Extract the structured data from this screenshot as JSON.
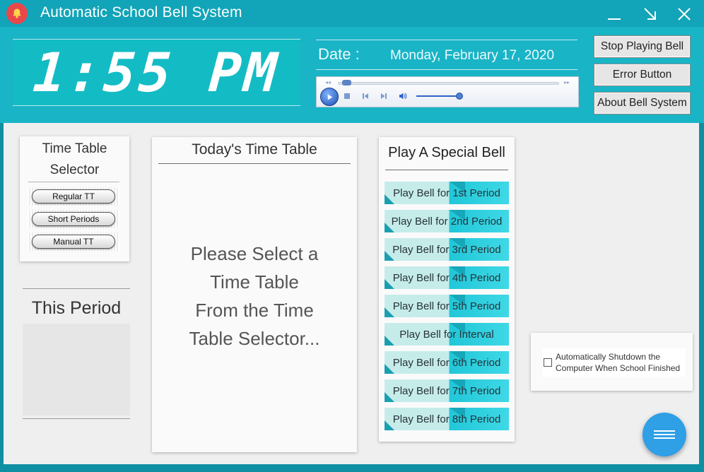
{
  "app": {
    "title": "Automatic School Bell System",
    "window_controls": [
      "minimize",
      "maximize",
      "close"
    ]
  },
  "header": {
    "time": "1:55 PM",
    "date_label": "Date :",
    "date_value": "Monday, February 17, 2020",
    "buttons": {
      "stop": "Stop Playing Bell",
      "error": "Error Button",
      "about": "About Bell System"
    },
    "player": {
      "controls": [
        "play-icon",
        "stop-icon",
        "previous-icon",
        "next-icon",
        "volume-icon"
      ],
      "seek_position": 0.02,
      "volume_level": 0.9
    }
  },
  "tt_selector": {
    "title_line1": "Time Table",
    "title_line2": "Selector",
    "options": [
      "Regular TT",
      "Short Periods",
      "Manual TT"
    ]
  },
  "this_period": {
    "label": "This Period"
  },
  "todays_tt": {
    "title": "Today's Time Table",
    "message_line1": "Please Select a",
    "message_line2": "Time Table",
    "message_line3": "From the Time",
    "message_line4": "Table Selector..."
  },
  "special_bell": {
    "title": "Play A Special Bell",
    "buttons": [
      "Play Bell for 1st Period",
      "Play Bell for 2nd Period",
      "Play Bell for 3rd Period",
      "Play Bell for 4th Period",
      "Play Bell for 5th Period",
      "Play Bell for Interval",
      "Play Bell for 6th Period",
      "Play Bell for 7th Period",
      "Play Bell for 8th Period"
    ]
  },
  "shutdown": {
    "line1": "Automatically Shutdown the",
    "line2": "Computer When School Finished",
    "checked": false
  },
  "colors": {
    "titlebar": "#12a4b8",
    "header": "#19b4c6",
    "clock_panel": "#13bcc4",
    "bell_button_light": "#c6ecea",
    "bell_button_accent": "#20c7d8",
    "fab": "#2f9fe6",
    "app_icon": "#e8484a"
  }
}
